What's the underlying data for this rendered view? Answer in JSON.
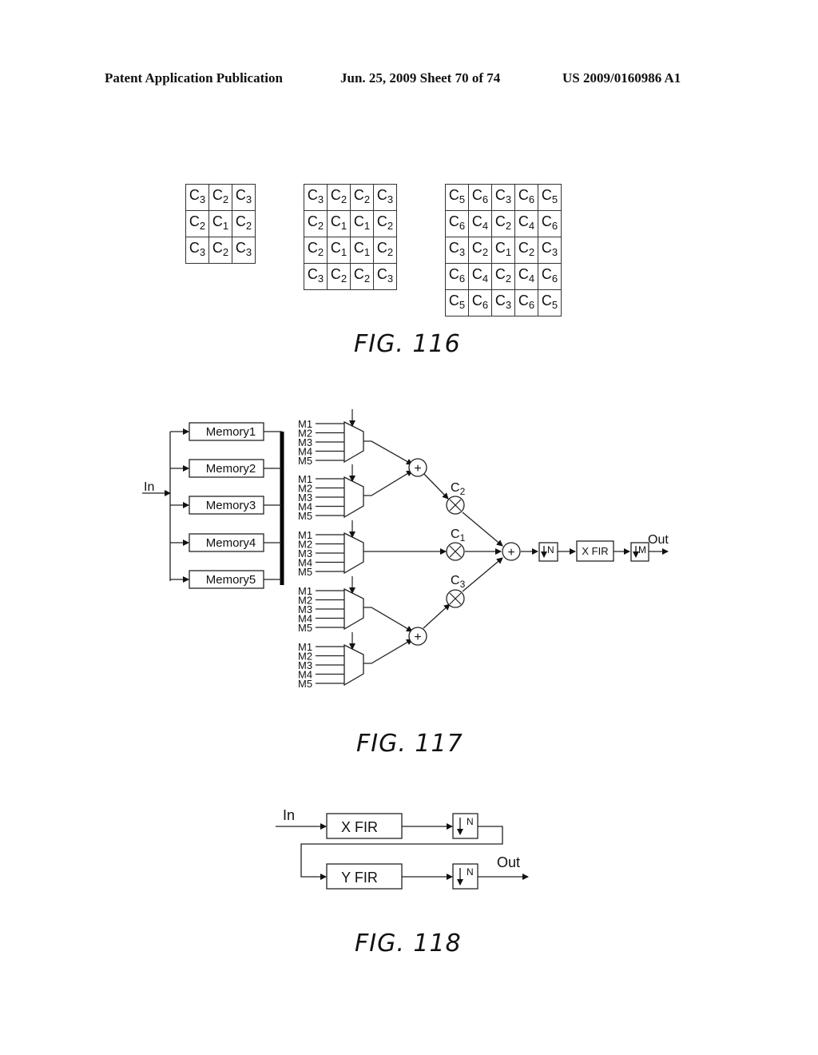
{
  "header": {
    "left": "Patent Application Publication",
    "date_sheet": "Jun. 25, 2009  Sheet 70 of 74",
    "number": "US 2009/0160986 A1"
  },
  "fig116": {
    "caption": "FIG. 116",
    "grids": [
      {
        "rows": [
          [
            "3",
            "2",
            "3"
          ],
          [
            "2",
            "1",
            "2"
          ],
          [
            "3",
            "2",
            "3"
          ]
        ]
      },
      {
        "rows": [
          [
            "3",
            "2",
            "2",
            "3"
          ],
          [
            "2",
            "1",
            "1",
            "2"
          ],
          [
            "2",
            "1",
            "1",
            "2"
          ],
          [
            "3",
            "2",
            "2",
            "3"
          ]
        ]
      },
      {
        "rows": [
          [
            "5",
            "6",
            "3",
            "6",
            "5"
          ],
          [
            "6",
            "4",
            "2",
            "4",
            "6"
          ],
          [
            "3",
            "2",
            "1",
            "2",
            "3"
          ],
          [
            "6",
            "4",
            "2",
            "4",
            "6"
          ],
          [
            "5",
            "6",
            "3",
            "6",
            "5"
          ]
        ]
      }
    ],
    "cell_prefix": "C"
  },
  "fig117": {
    "caption": "FIG. 117",
    "input_label": "In",
    "output_label": "Out",
    "memories": [
      "Memory1",
      "Memory2",
      "Memory3",
      "Memory4",
      "Memory5"
    ],
    "mux_inputs": [
      "M1",
      "M2",
      "M3",
      "M4",
      "M5"
    ],
    "coef_labels": {
      "c2": "C",
      "c2_sub": "2",
      "c1": "C",
      "c1_sub": "1",
      "c3": "C",
      "c3_sub": "3"
    },
    "adder_symbol": "+",
    "mult_symbol": "×",
    "down_n": "N",
    "down_m": "M",
    "xfir": "X FIR"
  },
  "fig118": {
    "caption": "FIG. 118",
    "input_label": "In",
    "output_label": "Out",
    "xfir": "X FIR",
    "yfir": "Y FIR",
    "down_n": "N"
  }
}
